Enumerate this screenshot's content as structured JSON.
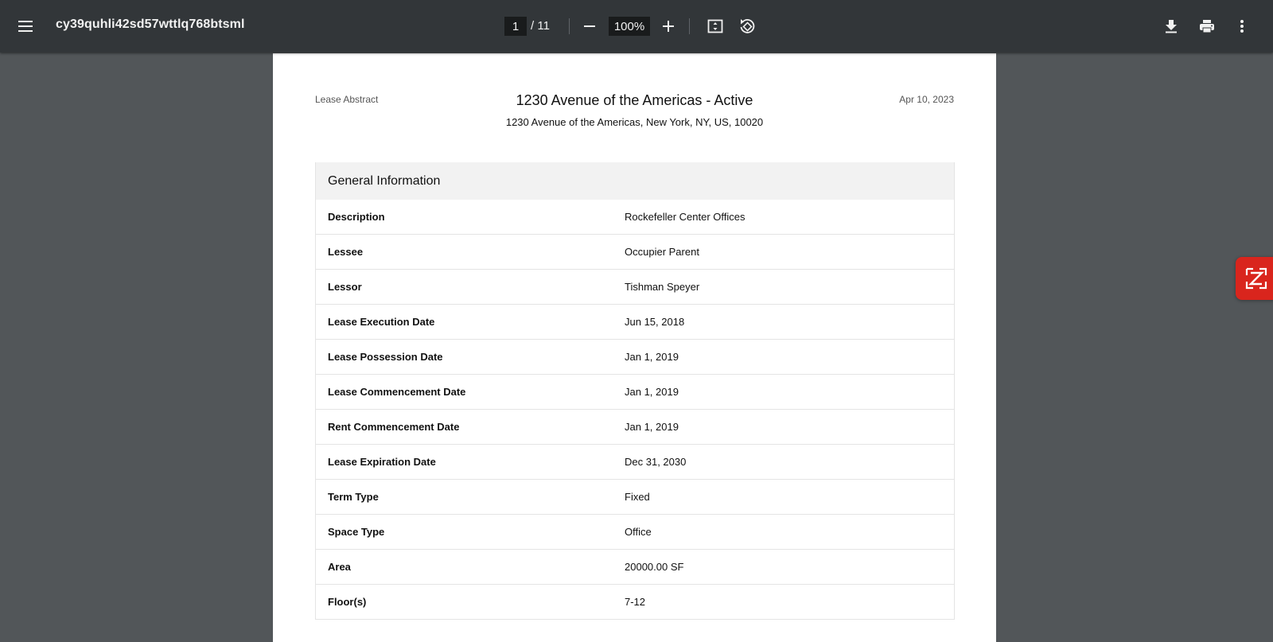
{
  "toolbar": {
    "menu_icon": "hamburger-menu-icon",
    "title": "cy39quhli42sd57wttlq768btsml",
    "page_current": "1",
    "page_total": "/ 11",
    "zoom": "100%",
    "icons": [
      "zoom-out-icon",
      "zoom-in-icon",
      "fit-page-icon",
      "rotate-icon",
      "download-icon",
      "print-icon",
      "more-vert-icon"
    ]
  },
  "document": {
    "header_left": "Lease Abstract",
    "title": "1230 Avenue of the Americas - Active",
    "address": "1230 Avenue of the Americas, New York, NY, US, 10020",
    "date": "Apr 10, 2023",
    "section": {
      "title": "General Information",
      "rows": [
        {
          "label": "Description",
          "value": "Rockefeller Center Offices"
        },
        {
          "label": "Lessee",
          "value": "Occupier Parent"
        },
        {
          "label": "Lessor",
          "value": "Tishman Speyer"
        },
        {
          "label": "Lease Execution Date",
          "value": "Jun 15, 2018"
        },
        {
          "label": "Lease Possession Date",
          "value": "Jan 1, 2019"
        },
        {
          "label": "Lease Commencement Date",
          "value": "Jan 1, 2019"
        },
        {
          "label": "Rent Commencement Date",
          "value": "Jan 1, 2019"
        },
        {
          "label": "Lease Expiration Date",
          "value": "Dec 31, 2030"
        },
        {
          "label": "Term Type",
          "value": "Fixed"
        },
        {
          "label": "Space Type",
          "value": "Office"
        },
        {
          "label": "Area",
          "value": "20000.00 SF"
        },
        {
          "label": "Floor(s)",
          "value": "7-12"
        }
      ]
    }
  },
  "side_widget": {
    "icon": "zotero-z-icon",
    "color": "#d9251d"
  }
}
